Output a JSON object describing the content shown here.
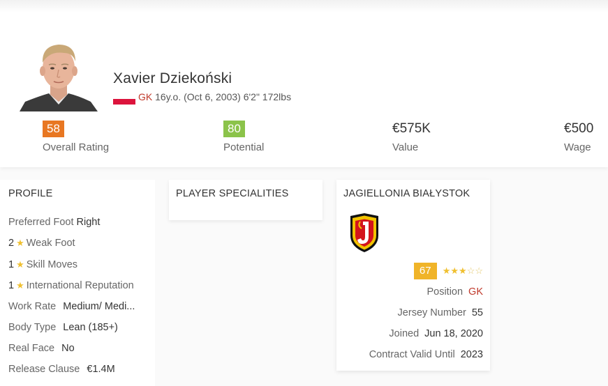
{
  "player": {
    "name": "Xavier Dziekoński",
    "position": "GK",
    "details": "16y.o. (Oct 6, 2003) 6'2\" 172lbs"
  },
  "stats": [
    {
      "value": "58",
      "label": "Overall Rating",
      "color": "#e87722"
    },
    {
      "value": "80",
      "label": "Potential",
      "color": "#8bc34a"
    },
    {
      "value": "€575K",
      "label": "Value"
    },
    {
      "value": "€500",
      "label": "Wage"
    }
  ],
  "profile": {
    "title": "PROFILE",
    "preferred_foot_label": "Preferred Foot",
    "preferred_foot": "Right",
    "weak_foot_value": "2",
    "weak_foot_label": "Weak Foot",
    "skill_moves_value": "1",
    "skill_moves_label": "Skill Moves",
    "intl_rep_value": "1",
    "intl_rep_label": "International Reputation",
    "work_rate_label": "Work Rate",
    "work_rate": "Medium/ Medi...",
    "body_type_label": "Body Type",
    "body_type": "Lean (185+)",
    "real_face_label": "Real Face",
    "real_face": "No",
    "release_clause_label": "Release Clause",
    "release_clause": "€1.4M"
  },
  "specialities": {
    "title": "PLAYER SPECIALITIES"
  },
  "club": {
    "name": "JAGIELLONIA BIAŁYSTOK",
    "rating": "67",
    "stars_on": 3,
    "stars_total": 5,
    "position_label": "Position",
    "position": "GK",
    "jersey_label": "Jersey Number",
    "jersey": "55",
    "joined_label": "Joined",
    "joined": "Jun 18, 2020",
    "contract_label": "Contract Valid Until",
    "contract": "2023"
  },
  "icons": {
    "star": "star-icon",
    "flag": "poland-flag-icon",
    "crest": "jagiellonia-crest-icon"
  }
}
